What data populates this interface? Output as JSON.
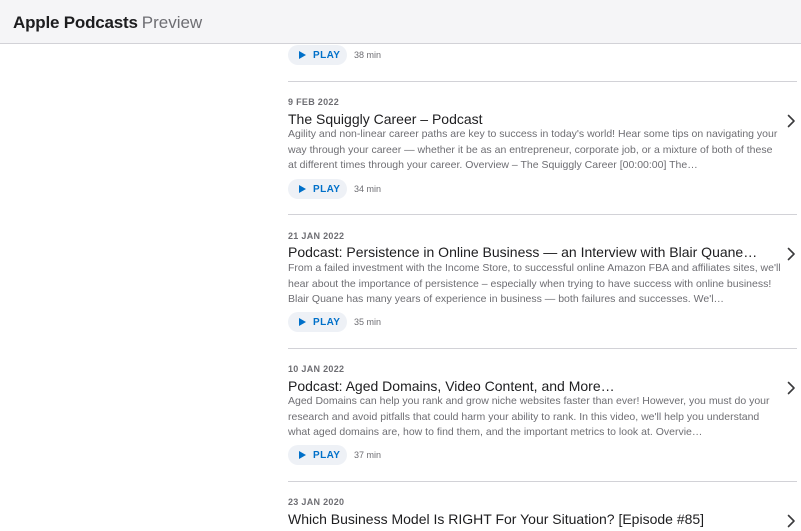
{
  "header": {
    "brand": "Apple Podcasts",
    "suffix": "Preview"
  },
  "play_label": "PLAY",
  "top_episode": {
    "duration": "38 min"
  },
  "episodes": [
    {
      "date": "9 FEB 2022",
      "title": "The Squiggly Career – Podcast",
      "description": "Agility and non-linear career paths are key to success in today's world! Hear some tips on navigating your way through your career — whether it be as an entrepreneur, corporate job, or a mixture of both of these at different times through your career. Overview – The Squiggly Career [00:00:00] The…",
      "duration": "34 min"
    },
    {
      "date": "21 JAN 2022",
      "title": "Podcast: Persistence in Online Business — an Interview with Blair Quane…",
      "description": "From a failed investment with the Income Store, to successful online Amazon FBA and affiliates sites, we'll hear about the importance of persistence – especially when trying to have success with online business! Blair Quane has many years of experience in business — both failures and successes. We'l…",
      "duration": "35 min"
    },
    {
      "date": "10 JAN 2022",
      "title": "Podcast: Aged Domains, Video Content, and More…",
      "description": "Aged Domains can help you rank and grow niche websites faster than ever! However, you must do your research and avoid pitfalls that could harm your ability to rank. In this video, we'll help you understand what aged domains are, how to find them, and the important metrics to look at. Overvie…",
      "duration": "37 min"
    },
    {
      "date": "23 JAN 2020",
      "title": "Which Business Model Is RIGHT For Your Situation? [Episode #85]"
    }
  ],
  "colors": {
    "accent": "#0070c9",
    "play_bg": "#eef1f6",
    "muted": "#6e6e73",
    "divider": "#d2d2d7",
    "header_bg": "#f5f5f7"
  }
}
